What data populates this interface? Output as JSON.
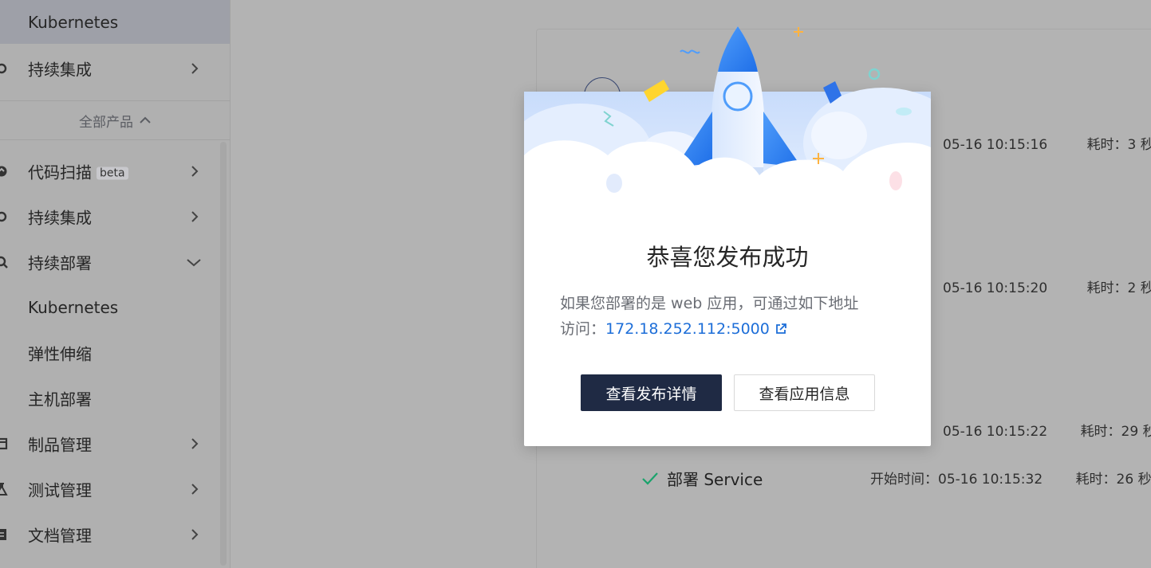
{
  "sidebar": {
    "items": [
      {
        "label": "Kubernetes",
        "active": true,
        "chevron": "none",
        "icon": ""
      },
      {
        "label": "持续集成",
        "chevron": "right",
        "icon": "ci-icon"
      },
      {
        "label": "代码扫描",
        "badge": "beta",
        "chevron": "right",
        "icon": "scan-icon"
      },
      {
        "label": "持续集成",
        "chevron": "right",
        "icon": "ci-icon"
      },
      {
        "label": "持续部署",
        "chevron": "down",
        "icon": "deploy-icon"
      },
      {
        "label": "Kubernetes",
        "chevron": "none",
        "icon": ""
      },
      {
        "label": "弹性伸缩",
        "chevron": "none",
        "icon": ""
      },
      {
        "label": "主机部署",
        "chevron": "none",
        "icon": ""
      },
      {
        "label": "制品管理",
        "chevron": "right",
        "icon": "artifact-icon"
      },
      {
        "label": "测试管理",
        "chevron": "right",
        "icon": "test-icon"
      },
      {
        "label": "文档管理",
        "chevron": "right",
        "icon": "doc-icon"
      }
    ],
    "group_label": "全部产品"
  },
  "pipeline": {
    "rows": [
      {
        "time": "05-16 10:15:16",
        "duration": "耗时：3 秒"
      },
      {
        "time": "05-16 10:15:20",
        "duration": "耗时：2 秒"
      },
      {
        "time": "05-16 10:15:22",
        "duration": "耗时：29 秒"
      },
      {
        "time": "开始时间：05-16 10:15:32",
        "duration": "耗时：26 秒"
      }
    ],
    "last_step": "部署 Service",
    "colors": {
      "success": "#1aa36c"
    }
  },
  "modal": {
    "title": "恭喜您发布成功",
    "desc": "如果您部署的是 web 应用，可通过如下地址",
    "link_prefix": "访问：",
    "link": "172.18.252.112:5000",
    "primary_button": "查看发布详情",
    "secondary_button": "查看应用信息",
    "colors": {
      "primary": "#1f2a44",
      "link": "#1d6ed8"
    }
  }
}
